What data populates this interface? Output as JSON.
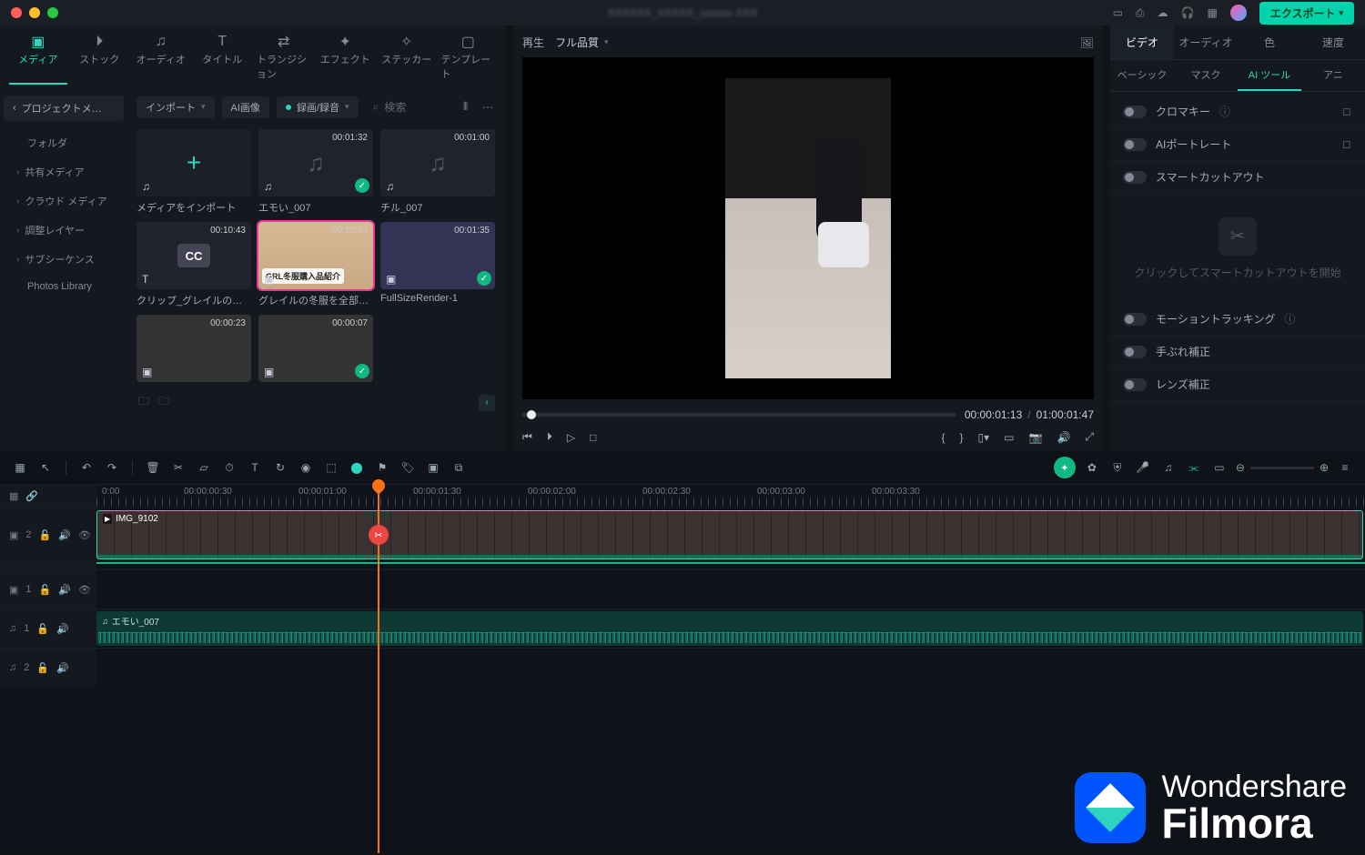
{
  "titlebar": {
    "title_blurred": "XXXXXX_XXXXX_xxxxxx XXX",
    "export": "エクスポート"
  },
  "media_tabs": [
    {
      "label": "メディア",
      "icon": "🖼"
    },
    {
      "label": "ストック",
      "icon": "⏵"
    },
    {
      "label": "オーディオ",
      "icon": "♫"
    },
    {
      "label": "タイトル",
      "icon": "T"
    },
    {
      "label": "トランジション",
      "icon": "⇄"
    },
    {
      "label": "エフェクト",
      "icon": "✦"
    },
    {
      "label": "ステッカー",
      "icon": "★"
    },
    {
      "label": "テンプレート",
      "icon": "▢"
    }
  ],
  "sidebar": {
    "project_media": "プロジェクトメ…",
    "folder": "フォルダ",
    "items": [
      "共有メディア",
      "クラウド メディア",
      "調整レイヤー",
      "サブシーケンス"
    ],
    "photos": "Photos Library"
  },
  "media_toolbar": {
    "import": "インポート",
    "ai_image": "AI画像",
    "record": "録画/録音",
    "search_placeholder": "検索"
  },
  "clips": [
    {
      "kind": "add",
      "label": "メディアをインポート"
    },
    {
      "kind": "audio",
      "dur": "00:01:32",
      "label": "エモい_007",
      "check": true
    },
    {
      "kind": "audio",
      "dur": "00:01:00",
      "label": "チル_007"
    },
    {
      "kind": "cc",
      "dur": "00:10:43",
      "label": "クリップ_グレイルの冬服を…"
    },
    {
      "kind": "video",
      "dur": "00:10:43",
      "label": "グレイルの冬服を全部着て…",
      "selected": true,
      "overlay": "GRL冬服購入品紹介"
    },
    {
      "kind": "video2",
      "dur": "00:01:35",
      "label": "FullSizeRender-1",
      "check": true
    },
    {
      "kind": "video3",
      "dur": "00:00:23",
      "label": ""
    },
    {
      "kind": "video3",
      "dur": "00:00:07",
      "label": "",
      "check": true
    }
  ],
  "preview": {
    "play": "再生",
    "quality": "フル品質",
    "current": "00:00:01:13",
    "total": "01:00:01:47"
  },
  "props": {
    "tabs": [
      "ビデオ",
      "オーディオ",
      "色",
      "速度"
    ],
    "subtabs": [
      "ベーシック",
      "マスク",
      "AI ツール",
      "アニ"
    ],
    "chromakey": "クロマキー",
    "ai_portrait": "AIポートレート",
    "smart_cutout": "スマートカットアウト",
    "smart_hint": "クリックしてスマートカットアウトを開始",
    "motion_track": "モーショントラッキング",
    "stabilize": "手ぶれ補正",
    "lens": "レンズ補正"
  },
  "ruler": {
    "labels": [
      "0:00",
      "00:00:00:30",
      "00:00:01:00",
      "00:00:01:30",
      "00:00:02:00",
      "00:00:02:30",
      "00:00:03:00",
      "00:00:03:30"
    ]
  },
  "tracks": {
    "video_clip": "IMG_9102",
    "audio_clip": "エモい_007",
    "t1": "1",
    "t2": "2"
  },
  "watermark": {
    "line1": "Wondershare",
    "line2": "Filmora"
  }
}
